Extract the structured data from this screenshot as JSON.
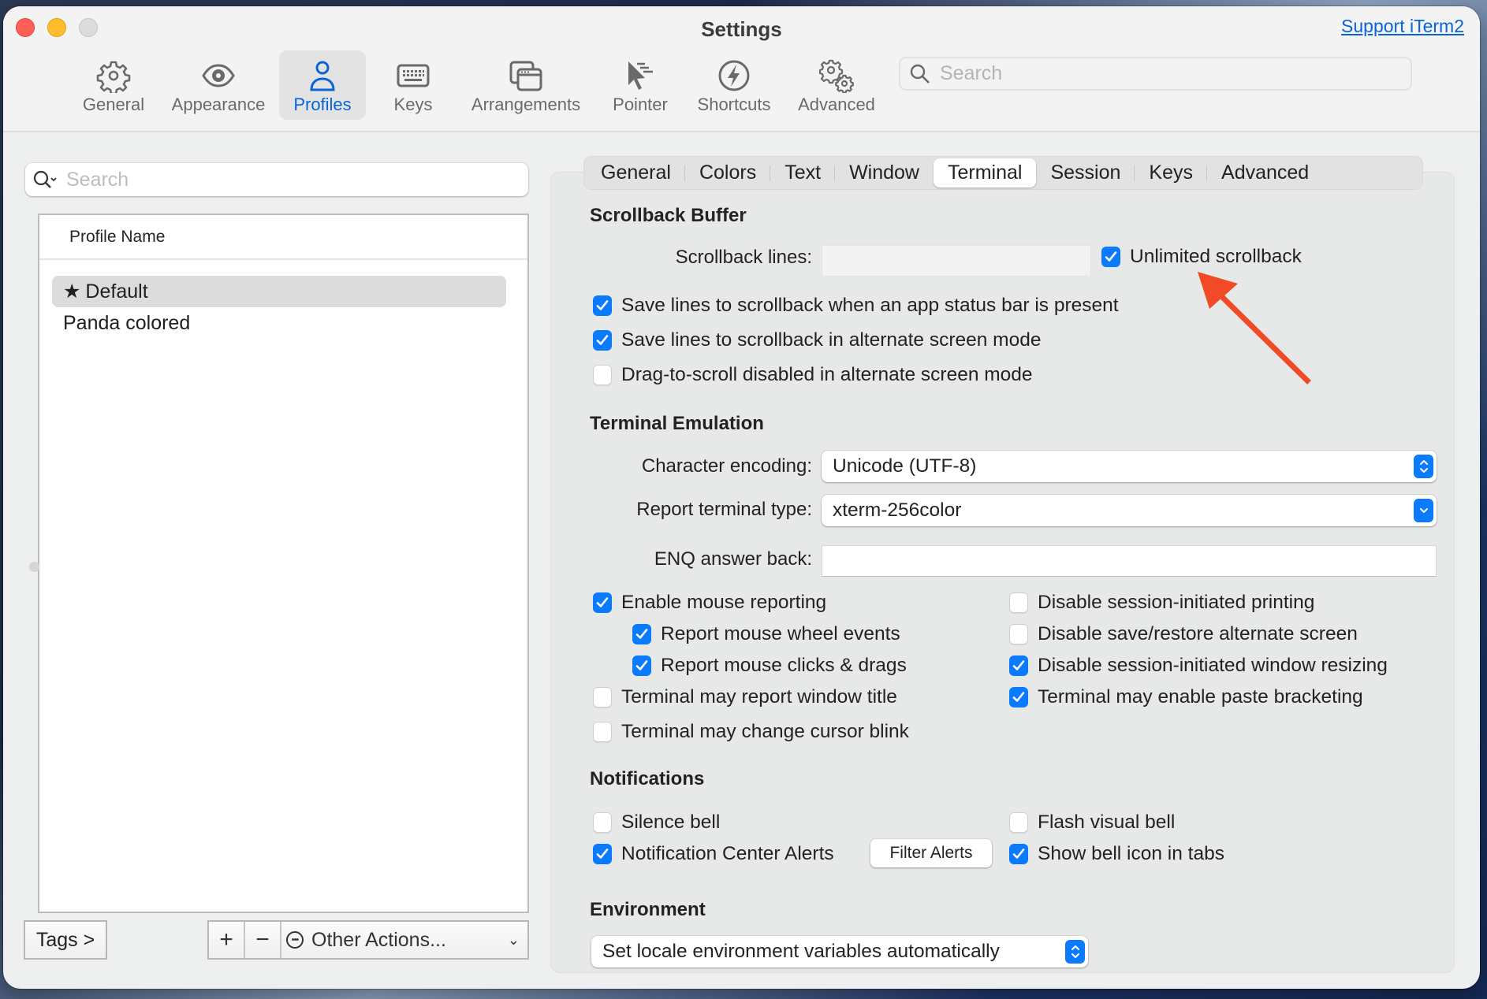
{
  "window": {
    "title": "Settings",
    "support_link": "Support iTerm2"
  },
  "toolbar": {
    "items": [
      {
        "label": "General",
        "icon": "gear-icon"
      },
      {
        "label": "Appearance",
        "icon": "eye-icon"
      },
      {
        "label": "Profiles",
        "icon": "person-icon",
        "selected": true
      },
      {
        "label": "Keys",
        "icon": "keyboard-icon"
      },
      {
        "label": "Arrangements",
        "icon": "windows-icon"
      },
      {
        "label": "Pointer",
        "icon": "pointer-icon"
      },
      {
        "label": "Shortcuts",
        "icon": "bolt-icon"
      },
      {
        "label": "Advanced",
        "icon": "gears-icon"
      }
    ],
    "search_placeholder": "Search"
  },
  "profiles": {
    "search_placeholder": "Search",
    "column_header": "Profile Name",
    "items": [
      {
        "name": "Default",
        "is_default": true,
        "selected": true
      },
      {
        "name": "Panda colored",
        "is_default": false,
        "selected": false
      }
    ],
    "tags_button": "Tags >",
    "add_button": "+",
    "remove_button": "−",
    "other_actions": "Other Actions..."
  },
  "tabs": {
    "items": [
      "General",
      "Colors",
      "Text",
      "Window",
      "Terminal",
      "Session",
      "Keys",
      "Advanced"
    ],
    "active": "Terminal"
  },
  "scrollback": {
    "title": "Scrollback Buffer",
    "lines_label": "Scrollback lines:",
    "lines_value": "",
    "unlimited": {
      "label": "Unlimited scrollback",
      "checked": true
    },
    "options": [
      {
        "label": "Save lines to scrollback when an app status bar is present",
        "checked": true
      },
      {
        "label": "Save lines to scrollback in alternate screen mode",
        "checked": true
      },
      {
        "label": "Drag-to-scroll disabled in alternate screen mode",
        "checked": false
      }
    ]
  },
  "emulation": {
    "title": "Terminal Emulation",
    "encoding_label": "Character encoding:",
    "encoding_value": "Unicode (UTF-8)",
    "term_type_label": "Report terminal type:",
    "term_type_value": "xterm-256color",
    "enq_label": "ENQ answer back:",
    "enq_value": "",
    "left_options": [
      {
        "label": "Enable mouse reporting",
        "checked": true
      },
      {
        "label": "Report mouse wheel events",
        "checked": true
      },
      {
        "label": "Report mouse clicks & drags",
        "checked": true
      },
      {
        "label": "Terminal may report window title",
        "checked": false
      },
      {
        "label": "Terminal may change cursor blink",
        "checked": false
      }
    ],
    "right_options": [
      {
        "label": "Disable session-initiated printing",
        "checked": false
      },
      {
        "label": "Disable save/restore alternate screen",
        "checked": false
      },
      {
        "label": "Disable session-initiated window resizing",
        "checked": true
      },
      {
        "label": "Terminal may enable paste bracketing",
        "checked": true
      }
    ]
  },
  "notifications": {
    "title": "Notifications",
    "silence_bell": {
      "label": "Silence bell",
      "checked": false
    },
    "flash_bell": {
      "label": "Flash visual bell",
      "checked": false
    },
    "center_alerts": {
      "label": "Notification Center Alerts",
      "checked": true
    },
    "filter_alerts_button": "Filter Alerts",
    "bell_icon_tabs": {
      "label": "Show bell icon in tabs",
      "checked": true
    }
  },
  "environment": {
    "title": "Environment",
    "locale_value": "Set locale environment variables automatically"
  },
  "colors": {
    "accent": "#0a7bff",
    "link": "#0a64d8",
    "annotation_arrow": "#f04a26"
  }
}
